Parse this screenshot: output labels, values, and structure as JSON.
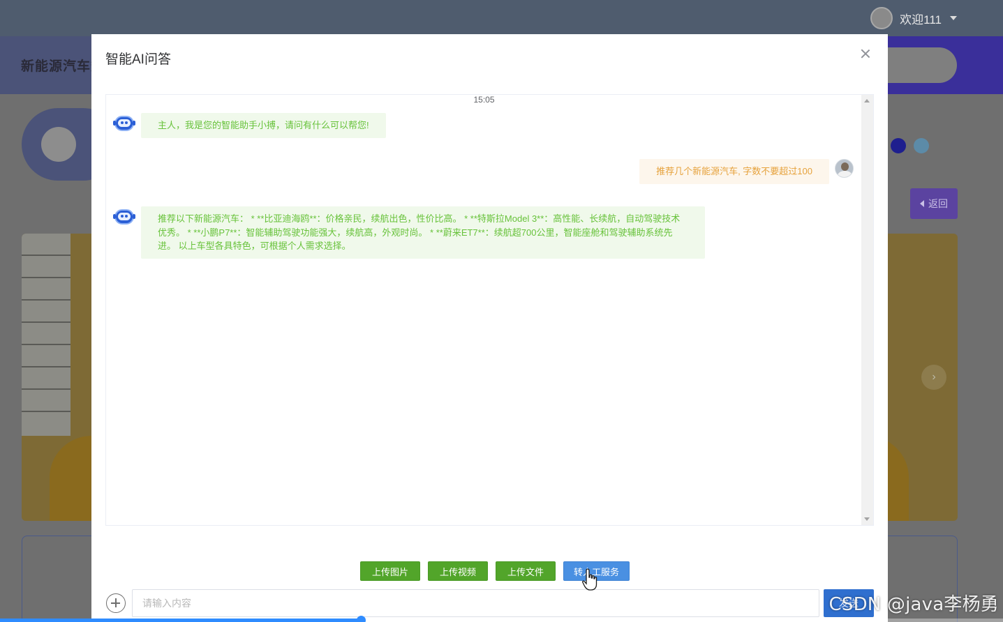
{
  "background": {
    "user_greeting": "欢迎111",
    "site_title": "新能源汽车数",
    "back_button": "返回"
  },
  "modal": {
    "title": "智能AI问答",
    "timestamp": "15:05",
    "messages": [
      {
        "role": "bot",
        "text": "主人，我是您的智能助手小搏，请问有什么可以帮您!"
      },
      {
        "role": "user",
        "text": "推荐几个新能源汽车, 字数不要超过100"
      },
      {
        "role": "bot",
        "text": "推荐以下新能源汽车： * **比亚迪海鸥**：价格亲民，续航出色，性价比高。 * **特斯拉Model 3**：高性能、长续航，自动驾驶技术优秀。 * **小鹏P7**：智能辅助驾驶功能强大，续航高，外观时尚。 * **蔚来ET7**：续航超700公里，智能座舱和驾驶辅助系统先进。 以上车型各具特色，可根据个人需求选择。"
      }
    ],
    "actions": {
      "upload_image": "上传图片",
      "upload_video": "上传视频",
      "upload_file": "上传文件",
      "transfer_human": "转人工服务"
    },
    "input": {
      "placeholder": "请输入内容",
      "value": ""
    },
    "send_label": "发送"
  },
  "video_progress": 0.36,
  "watermark": "CSDN @java李杨勇",
  "colors": {
    "bot_bubble_bg": "#f0f9eb",
    "bot_text": "#67c23a",
    "user_bubble_bg": "#fdf6ec",
    "user_text": "#e6a23c",
    "action_green": "#52a52a",
    "action_blue": "#4a90e2"
  }
}
